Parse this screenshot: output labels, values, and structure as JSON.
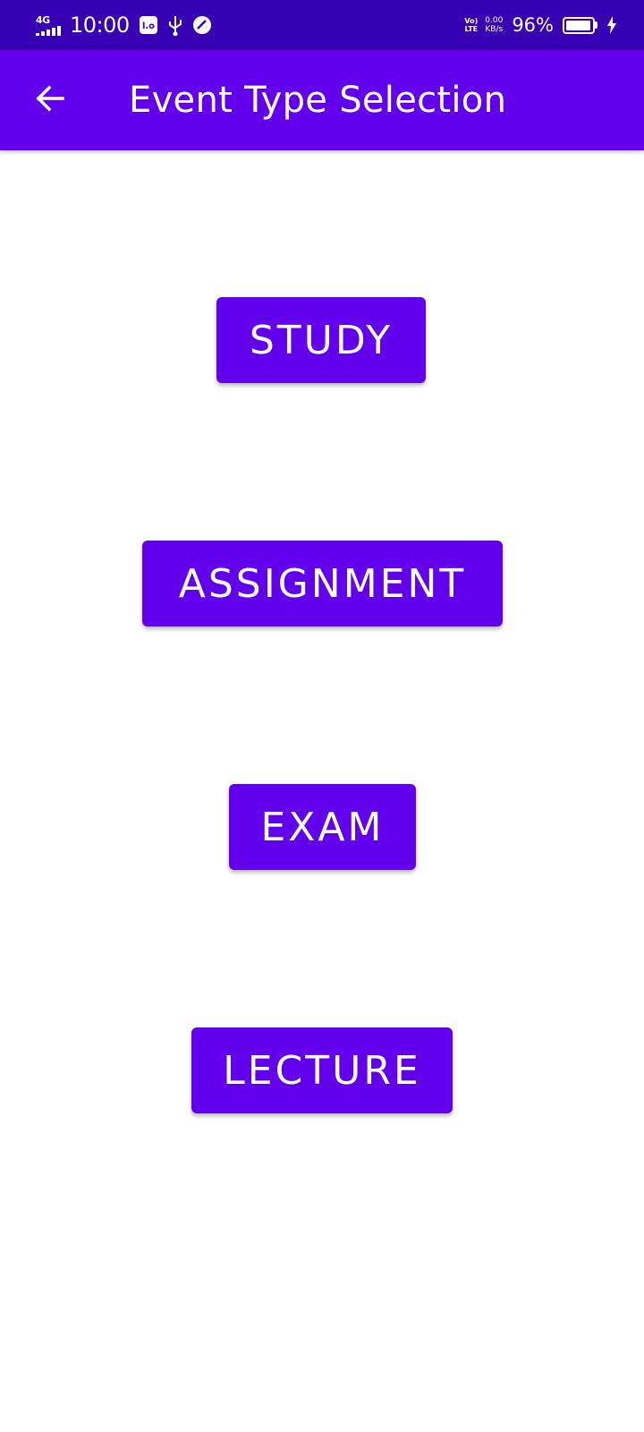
{
  "status_bar": {
    "network": "4G",
    "time": "10:00",
    "volte_top": "Vo)",
    "volte_bottom": "LTE",
    "speed_value": "0.00",
    "speed_unit": "KB/s",
    "battery_percent": "96%",
    "battery_level": 0.96
  },
  "app_bar": {
    "title": "Event Type Selection",
    "back_icon": "arrow-left-icon"
  },
  "buttons": {
    "study": "STUDY",
    "assignment": "ASSIGNMENT",
    "exam": "EXAM",
    "lecture": "LECTURE"
  },
  "colors": {
    "status_bar": "#3700B3",
    "primary": "#6200EE",
    "background": "#ffffff",
    "on_primary": "#ffffff"
  }
}
